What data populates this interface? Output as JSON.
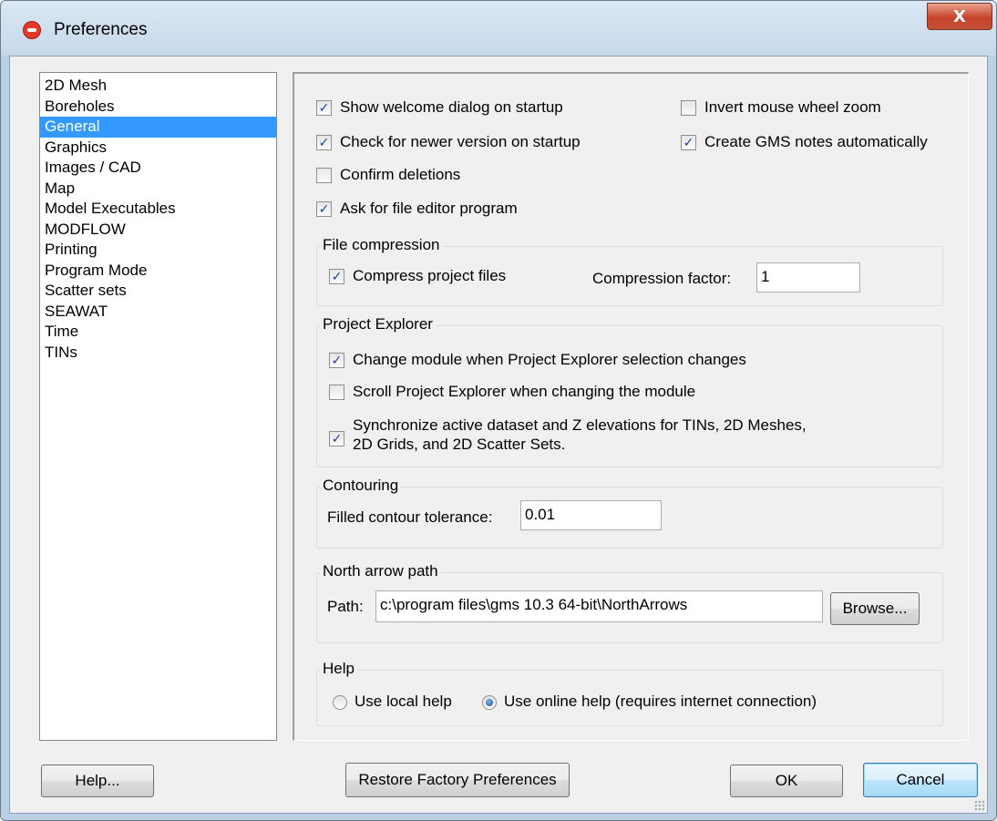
{
  "window": {
    "title": "Preferences",
    "close_glyph": "X"
  },
  "categories": [
    {
      "label": "2D Mesh"
    },
    {
      "label": "Boreholes"
    },
    {
      "label": "General",
      "selected": true
    },
    {
      "label": "Graphics"
    },
    {
      "label": "Images / CAD"
    },
    {
      "label": "Map"
    },
    {
      "label": "Model Executables"
    },
    {
      "label": "MODFLOW"
    },
    {
      "label": "Printing"
    },
    {
      "label": "Program Mode"
    },
    {
      "label": "Scatter sets"
    },
    {
      "label": "SEAWAT"
    },
    {
      "label": "Time"
    },
    {
      "label": "TINs"
    }
  ],
  "general": {
    "show_welcome": {
      "label": "Show welcome dialog on startup",
      "checked": true
    },
    "invert_wheel": {
      "label": "Invert mouse wheel zoom",
      "checked": false
    },
    "check_newer": {
      "label": "Check for newer version on startup",
      "checked": true
    },
    "create_notes": {
      "label": "Create GMS notes automatically",
      "checked": true
    },
    "confirm_deletions": {
      "label": "Confirm deletions",
      "checked": false
    },
    "ask_editor": {
      "label": "Ask for file editor program",
      "checked": true
    }
  },
  "file_compression": {
    "title": "File compression",
    "compress": {
      "label": "Compress project files",
      "checked": true
    },
    "factor_label": "Compression factor:",
    "factor_value": "1"
  },
  "project_explorer": {
    "title": "Project Explorer",
    "change_module": {
      "label": "Change module when Project Explorer selection changes",
      "checked": true
    },
    "scroll": {
      "label": "Scroll Project Explorer when changing the module",
      "checked": false
    },
    "sync": {
      "label_line1": "Synchronize active dataset and Z elevations for TINs, 2D Meshes,",
      "label_line2": "2D Grids, and 2D Scatter Sets.",
      "checked": true
    }
  },
  "contouring": {
    "title": "Contouring",
    "tolerance_label": "Filled contour tolerance:",
    "tolerance_value": "0.01"
  },
  "north_arrow": {
    "title": "North arrow path",
    "path_label": "Path:",
    "path_value": "c:\\program files\\gms 10.3 64-bit\\NorthArrows",
    "browse_label": "Browse..."
  },
  "help_group": {
    "title": "Help",
    "local_label": "Use local help",
    "online_label": "Use online help (requires internet connection)",
    "selected": "online"
  },
  "buttons": {
    "help": "Help...",
    "restore": "Restore Factory Preferences",
    "ok": "OK",
    "cancel": "Cancel"
  },
  "check_glyph": "✓"
}
